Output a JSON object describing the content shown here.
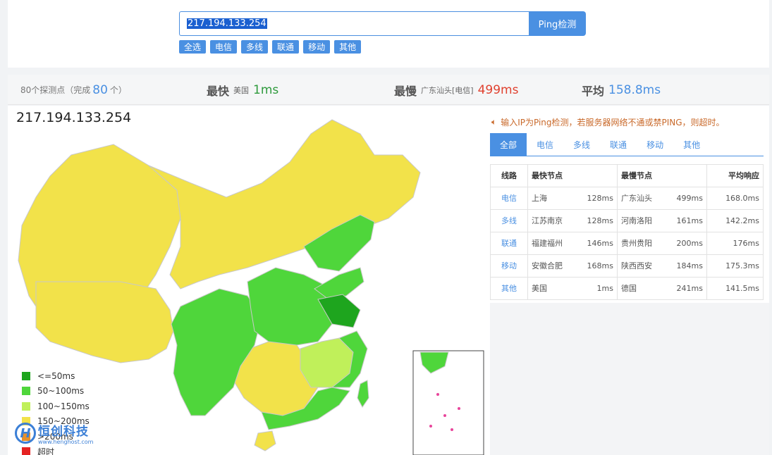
{
  "search": {
    "value": "217.194.133.254",
    "button_label": "Ping检测"
  },
  "filters": [
    "全选",
    "电信",
    "多线",
    "联通",
    "移动",
    "其他"
  ],
  "summary": {
    "probe_prefix": "80个探测点（完成",
    "probe_count": "80",
    "probe_suffix": "个）",
    "fastest_label": "最快",
    "fastest_location": "美国",
    "fastest_value": "1ms",
    "slowest_label": "最慢",
    "slowest_location": "广东汕头[电信]",
    "slowest_value": "499ms",
    "average_label": "平均",
    "average_value": "158.8ms"
  },
  "map_title": "217.194.133.254",
  "legend": [
    {
      "label": "<=50ms",
      "color": "#1ea51e"
    },
    {
      "label": "50~100ms",
      "color": "#4fd63b"
    },
    {
      "label": "100~150ms",
      "color": "#c0f05a"
    },
    {
      "label": "150~200ms",
      "color": "#f2e24a"
    },
    {
      "label": ">200ms",
      "color": "#e7912b"
    },
    {
      "label": "超时",
      "color": "#e52222"
    }
  ],
  "logo": {
    "cn": "恒创科技",
    "en": "www.henghost.com",
    "mark": "H"
  },
  "notice": "输入IP为Ping检测，若服务器网络不通或禁PING，则超时。",
  "tabs": [
    "全部",
    "电信",
    "多线",
    "联通",
    "移动",
    "其他"
  ],
  "table": {
    "headers": {
      "line": "线路",
      "fastest": "最快节点",
      "slowest": "最慢节点",
      "average": "平均响应"
    },
    "rows": [
      {
        "line": "电信",
        "fast_node": "上海",
        "fast_ms": "128ms",
        "slow_node": "广东汕头",
        "slow_ms": "499ms",
        "avg": "168.0ms"
      },
      {
        "line": "多线",
        "fast_node": "江苏南京",
        "fast_ms": "128ms",
        "slow_node": "河南洛阳",
        "slow_ms": "161ms",
        "avg": "142.2ms"
      },
      {
        "line": "联通",
        "fast_node": "福建福州",
        "fast_ms": "146ms",
        "slow_node": "贵州贵阳",
        "slow_ms": "200ms",
        "avg": "176ms"
      },
      {
        "line": "移动",
        "fast_node": "安徽合肥",
        "fast_ms": "168ms",
        "slow_node": "陕西西安",
        "slow_ms": "184ms",
        "avg": "175.3ms"
      },
      {
        "line": "其他",
        "fast_node": "美国",
        "fast_ms": "1ms",
        "slow_node": "德国",
        "slow_ms": "241ms",
        "avg": "141.5ms"
      }
    ]
  },
  "colors": {
    "accent": "#4a90e2",
    "fast": "#2e9a3c",
    "slow": "#e0412f",
    "map_yellow": "#f2e24a",
    "map_green": "#4fd63b",
    "map_dark_green": "#1ea51e",
    "map_light_green": "#c0f05a"
  }
}
